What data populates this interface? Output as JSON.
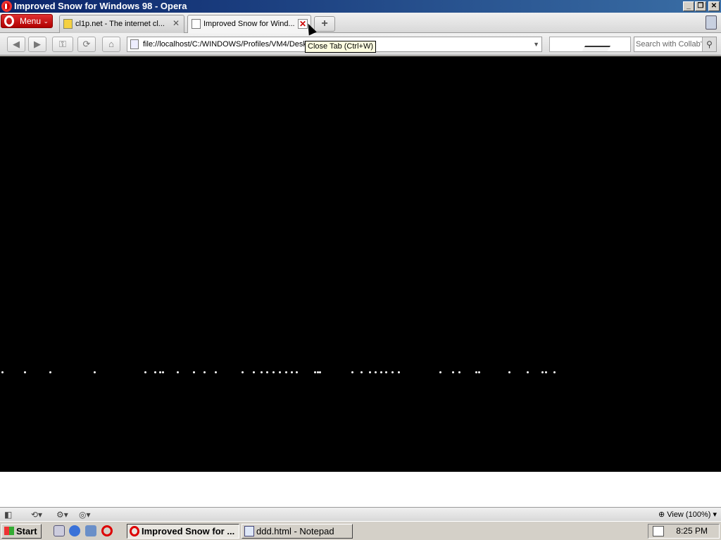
{
  "window": {
    "title": "Improved Snow for Windows 98 - Opera",
    "controls": [
      "minimize",
      "restore",
      "close"
    ]
  },
  "menu_button": {
    "label": "Menu"
  },
  "tabs": [
    {
      "label": "cl1p.net - The internet cl...",
      "active": false
    },
    {
      "label": "Improved Snow for Wind...",
      "active": true
    }
  ],
  "tooltip": {
    "text": "Close Tab (Ctrl+W)"
  },
  "address_bar": {
    "url": "file://localhost/C:/WINDOWS/Profiles/VM4/Desk"
  },
  "search": {
    "placeholder": "Search with Collab'"
  },
  "content": {
    "background": "#000000",
    "snowflake_x": [
      3,
      35,
      71,
      134,
      206,
      220,
      227,
      231,
      252,
      275,
      290,
      306,
      344,
      360,
      371,
      379,
      388,
      397,
      406,
      414,
      421,
      447,
      451,
      454,
      500,
      513,
      525,
      533,
      541,
      548,
      557,
      566,
      625,
      643,
      652,
      676,
      680,
      723,
      749,
      770,
      775,
      787
    ]
  },
  "statusbar": {
    "zoom_label": "View (100%)"
  },
  "taskbar": {
    "start_label": "Start",
    "buttons": [
      {
        "label": "Improved Snow for ...",
        "active": true
      },
      {
        "label": "ddd.html - Notepad",
        "active": false
      }
    ],
    "clock": "8:25 PM"
  },
  "colors": {
    "titlebar": "#0a246a",
    "menu_button": "#c00000",
    "taskbar": "#d4d0c8"
  }
}
